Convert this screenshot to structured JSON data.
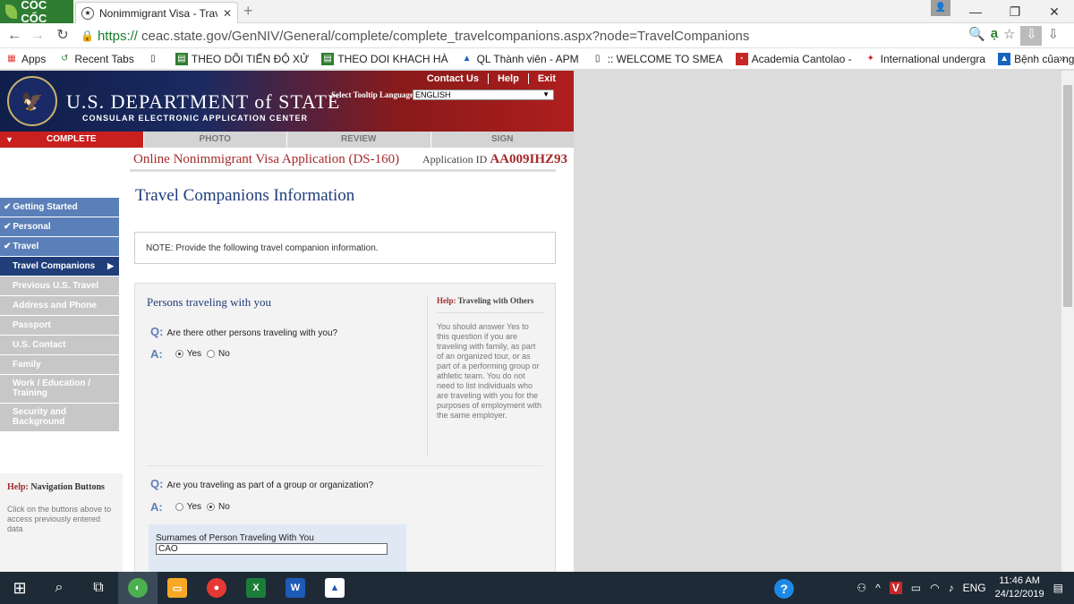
{
  "browser": {
    "brand": "CỐC CỐC",
    "tab_title": "Nonimmigrant Visa - Trave",
    "url_scheme": "https://",
    "url_rest": "ceac.state.gov/GenNIV/General/complete/complete_travelcompanions.aspx?node=TravelCompanions",
    "bookmarks": [
      {
        "label": "Apps"
      },
      {
        "label": "Recent Tabs"
      },
      {
        "label": ""
      },
      {
        "label": "THEO DÕI TIẾN ĐỘ XỬ"
      },
      {
        "label": "THEO DOI KHACH HÀ"
      },
      {
        "label": "QL Thành viên - APM"
      },
      {
        "label": ":: WELCOME TO SMEA"
      },
      {
        "label": "Academia Cantolao -"
      },
      {
        "label": "International undergra"
      },
      {
        "label": "Bệnh của người cầu tô"
      }
    ],
    "bookmarks_more": "»"
  },
  "header": {
    "links": [
      "Contact Us",
      "Help",
      "Exit"
    ],
    "dept_name": "U.S. DEPARTMENT of STATE",
    "dept_sub": "CONSULAR ELECTRONIC APPLICATION CENTER",
    "tooltip_lang_label": "Select Tooltip Language",
    "tooltip_lang_value": "ENGLISH",
    "steps": [
      "COMPLETE",
      "PHOTO",
      "REVIEW",
      "SIGN"
    ]
  },
  "app": {
    "title": "Online Nonimmigrant Visa Application (DS-160)",
    "id_label": "Application ID",
    "id_value": "AA009IHZ93"
  },
  "sidebar": {
    "items": [
      {
        "label": "Getting Started",
        "state": "done"
      },
      {
        "label": "Personal",
        "state": "done"
      },
      {
        "label": "Travel",
        "state": "done"
      },
      {
        "label": "Travel Companions",
        "state": "current"
      },
      {
        "label": "Previous U.S. Travel",
        "state": "todo"
      },
      {
        "label": "Address and Phone",
        "state": "todo"
      },
      {
        "label": "Passport",
        "state": "todo"
      },
      {
        "label": "U.S. Contact",
        "state": "todo"
      },
      {
        "label": "Family",
        "state": "todo"
      },
      {
        "label": "Work / Education / Training",
        "state": "todo"
      },
      {
        "label": "Security and Background",
        "state": "todo"
      }
    ],
    "help_prefix": "Help:",
    "help_title": "Navigation Buttons",
    "help_body": "Click on the buttons above to access previously entered data"
  },
  "main": {
    "page_title": "Travel Companions Information",
    "note": "NOTE: Provide the following travel companion information.",
    "section_title": "Persons traveling with you",
    "q1": "Are there other persons traveling with you?",
    "q1_answer": "Yes",
    "q2": "Are you traveling as part of a group or organization?",
    "q2_answer": "No",
    "q_marker": "Q:",
    "a_marker": "A:",
    "yes_label": "Yes",
    "no_label": "No",
    "help_prefix": "Help:",
    "help_title": "Traveling with Others",
    "help_body": "You should answer Yes to this question if you are traveling with family, as part of an organized tour, or as part of a performing group or athletic team. You do not need to list individuals who are traveling with you for the purposes of employment with the same employer.",
    "surname_label": "Surnames of Person Traveling With You",
    "surname_value": "CAO"
  },
  "taskbar": {
    "lang": "ENG",
    "time": "11:46 AM",
    "date": "24/12/2019"
  }
}
